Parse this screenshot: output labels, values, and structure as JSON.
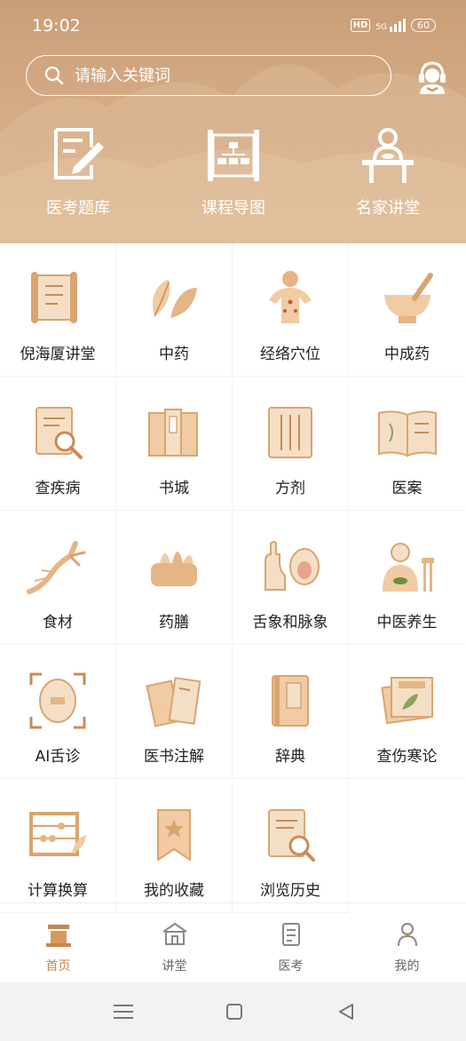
{
  "status": {
    "time": "19:02",
    "hd": "HD",
    "network": "5G",
    "battery": "60"
  },
  "search": {
    "placeholder": "请输入关键词"
  },
  "top_items": [
    {
      "label": "医考题库",
      "icon": "exam-pen-icon"
    },
    {
      "label": "课程导图",
      "icon": "scroll-chart-icon"
    },
    {
      "label": "名家讲堂",
      "icon": "lecturer-icon"
    }
  ],
  "grid": [
    {
      "label": "倪海厦讲堂",
      "icon": "scroll-book-icon"
    },
    {
      "label": "中药",
      "icon": "herb-leaf-icon"
    },
    {
      "label": "经络穴位",
      "icon": "acupoint-figure-icon"
    },
    {
      "label": "中成药",
      "icon": "mortar-icon"
    },
    {
      "label": "查疾病",
      "icon": "magnifier-report-icon"
    },
    {
      "label": "书城",
      "icon": "books-icon"
    },
    {
      "label": "方剂",
      "icon": "prescription-icon"
    },
    {
      "label": "医案",
      "icon": "open-book-icon"
    },
    {
      "label": "食材",
      "icon": "ginseng-icon"
    },
    {
      "label": "药膳",
      "icon": "food-basket-icon"
    },
    {
      "label": "舌象和脉象",
      "icon": "tongue-pulse-icon"
    },
    {
      "label": "中医养生",
      "icon": "elder-icon"
    },
    {
      "label": "AI舌诊",
      "icon": "ai-scan-icon"
    },
    {
      "label": "医书注解",
      "icon": "annotated-books-icon"
    },
    {
      "label": "辞典",
      "icon": "dictionary-icon"
    },
    {
      "label": "查伤寒论",
      "icon": "classic-text-icon"
    },
    {
      "label": "计算换算",
      "icon": "abacus-icon"
    },
    {
      "label": "我的收藏",
      "icon": "bookmark-star-icon"
    },
    {
      "label": "浏览历史",
      "icon": "history-doc-icon"
    }
  ],
  "nav": [
    {
      "label": "首页",
      "icon": "home-temple-icon",
      "active": true
    },
    {
      "label": "讲堂",
      "icon": "hall-icon",
      "active": false
    },
    {
      "label": "医考",
      "icon": "exam-doc-icon",
      "active": false
    },
    {
      "label": "我的",
      "icon": "profile-icon",
      "active": false
    }
  ],
  "colors": {
    "header": "#d4aa84",
    "accent": "#c4874d",
    "icon_tan": "#e2b98d"
  }
}
